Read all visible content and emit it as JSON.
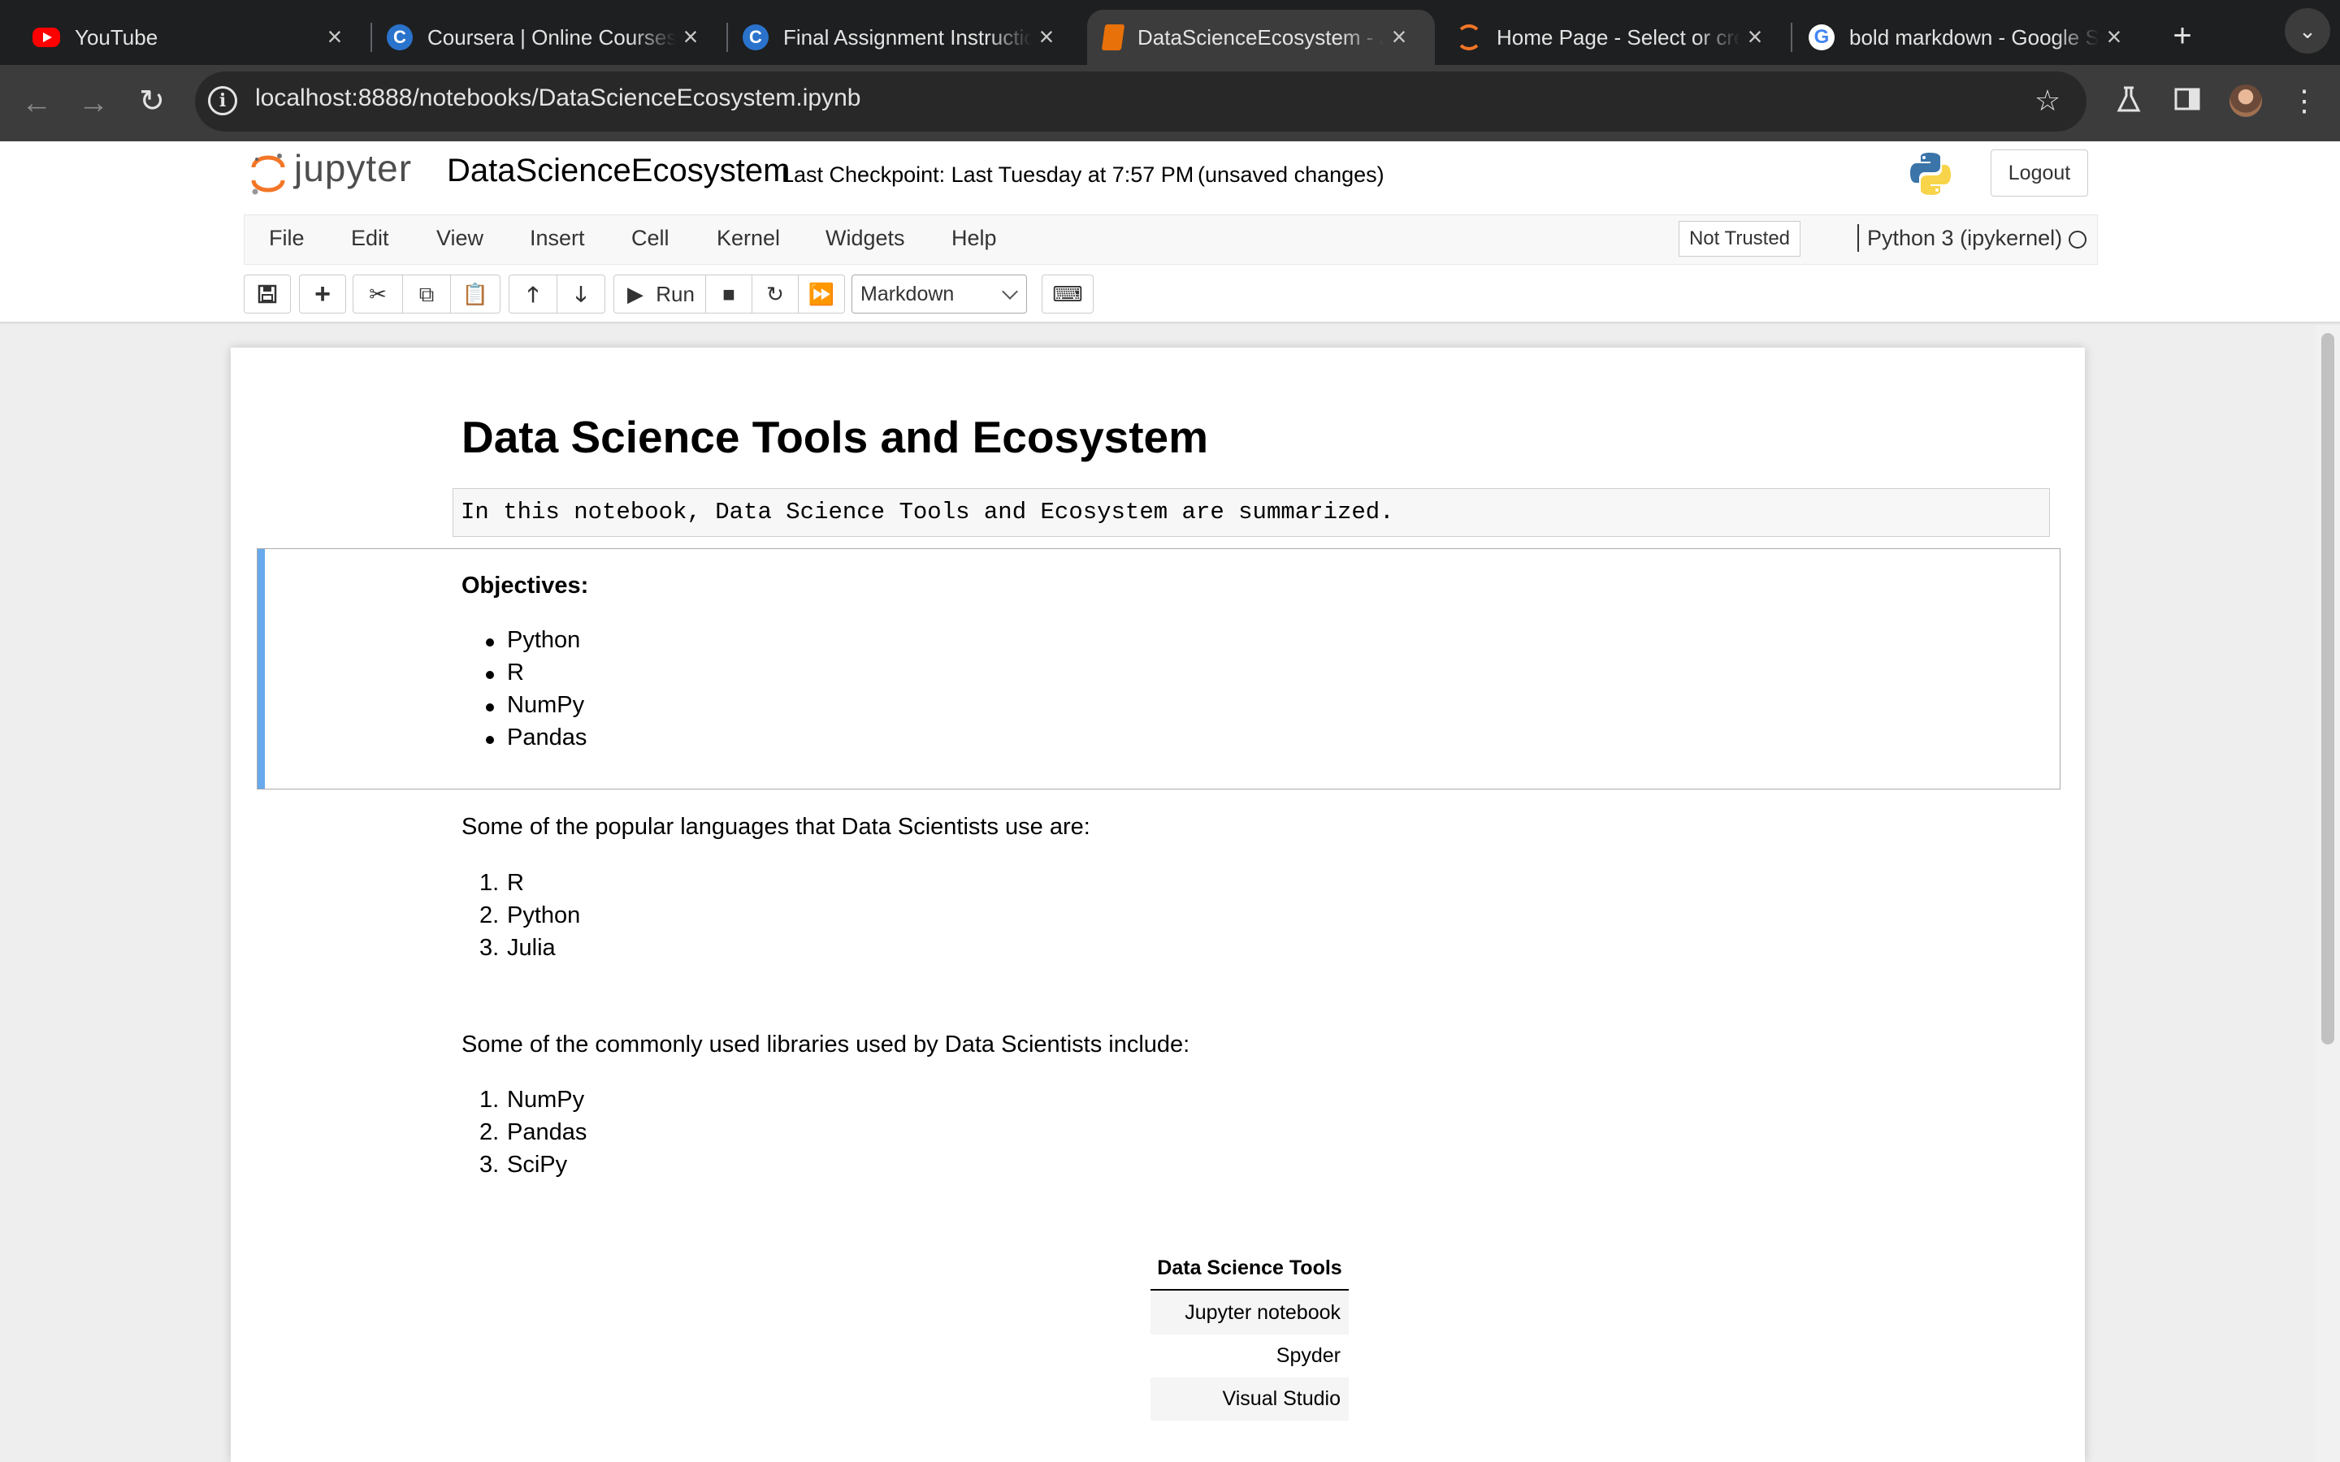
{
  "browser": {
    "tabs": [
      {
        "title": "YouTube",
        "icon": "youtube-icon",
        "active": false
      },
      {
        "title": "Coursera | Online Courses",
        "icon": "coursera-icon",
        "active": false
      },
      {
        "title": "Final Assignment Instructions",
        "icon": "coursera-icon",
        "active": false
      },
      {
        "title": "DataScienceEcosystem - Jupyter",
        "icon": "notebook-icon",
        "active": true
      },
      {
        "title": "Home Page - Select or create",
        "icon": "jupyter-icon",
        "active": false
      },
      {
        "title": "bold markdown - Google Search",
        "icon": "google-icon",
        "active": false
      }
    ],
    "url": "localhost:8888/notebooks/DataScienceEcosystem.ipynb"
  },
  "jupyter": {
    "logo_text": "jupyter",
    "notebook_name": "DataScienceEcosystem",
    "checkpoint": "Last Checkpoint: Last Tuesday at 7:57 PM",
    "unsaved": "(unsaved changes)",
    "logout_label": "Logout",
    "menus": [
      "File",
      "Edit",
      "View",
      "Insert",
      "Cell",
      "Kernel",
      "Widgets",
      "Help"
    ],
    "trust_label": "Not Trusted",
    "kernel_name": "Python 3 (ipykernel)",
    "run_label": "Run",
    "cell_type": "Markdown"
  },
  "notebook": {
    "title": "Data Science Tools and Ecosystem",
    "intro_code": "In this notebook, Data Science Tools and Ecosystem are summarized.",
    "objectives_label": "Objectives:",
    "objectives": [
      "Python",
      "R",
      "NumPy",
      "Pandas"
    ],
    "languages_intro": "Some of the popular languages that Data Scientists use are:",
    "languages": [
      "R",
      "Python",
      "Julia"
    ],
    "libraries_intro": "Some of the commonly used libraries used by Data Scientists include:",
    "libraries": [
      "NumPy",
      "Pandas",
      "SciPy"
    ],
    "table": {
      "header": "Data Science Tools",
      "rows": [
        "Jupyter notebook",
        "Spyder",
        "Visual Studio"
      ]
    }
  },
  "colors": {
    "selected_cell_bar": "#66a9ec",
    "jupyter_orange": "#f37626",
    "browser_dark": "#1e1f20"
  }
}
